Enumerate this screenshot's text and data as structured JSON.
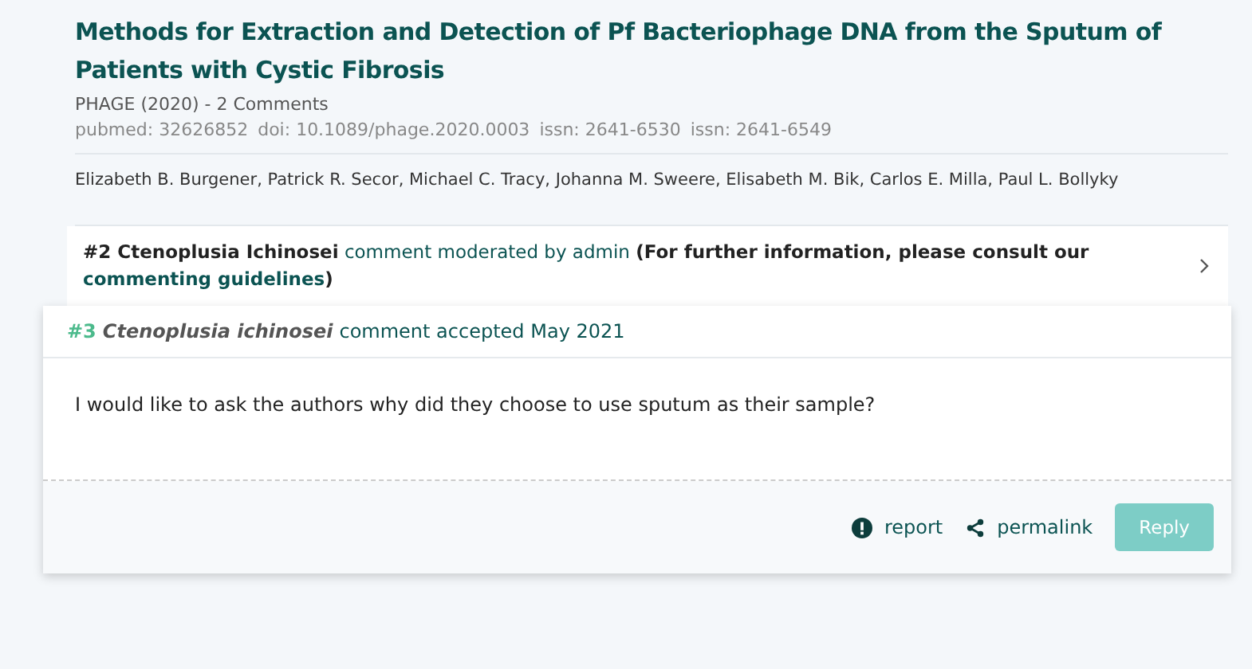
{
  "article": {
    "title": "Methods for Extraction and Detection of Pf Bacteriophage DNA from the Sputum of Patients with Cystic Fibrosis",
    "journal": "PHAGE (2020) - 2 Comments",
    "identifiers": [
      "pubmed: 32626852",
      "doi: 10.1089/phage.2020.0003",
      "issn: 2641-6530",
      "issn: 2641-6549"
    ],
    "authors": "Elizabeth B. Burgener, Patrick R. Secor, Michael C. Tracy, Johanna M. Sweere, Elisabeth M. Bik, Carlos E. Milla, Paul L. Bollyky"
  },
  "comments": [
    {
      "kind": "moderated",
      "number": "#2",
      "author": "Ctenoplusia Ichinosei",
      "status": "comment moderated by admin",
      "note": "(For further information, please consult our",
      "link": "commenting guidelines",
      "note_end": ")"
    },
    {
      "kind": "open",
      "number": "#3",
      "author": "Ctenoplusia ichinosei",
      "status": "comment accepted May 2021",
      "body": "I would like to ask the authors why did they choose to use sputum as their sample?",
      "actions": [
        "report",
        "permalink"
      ],
      "reply": "Reply",
      "reply_disabled": true
    }
  ]
}
